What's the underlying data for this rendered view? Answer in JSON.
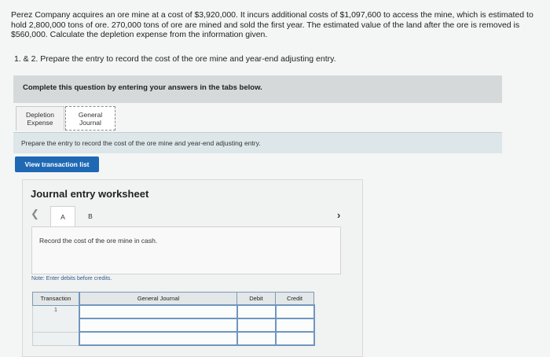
{
  "problem": {
    "text": "Perez Company acquires an ore mine at a cost of $3,920,000. It incurs additional costs of $1,097,600 to access the mine, which is estimated to hold 2,800,000 tons of ore. 270,000 tons of ore are mined and sold the first year. The estimated value of the land after the ore is removed is $560,000. Calculate the depletion expense from the information given.",
    "question": "1. & 2. Prepare the entry to record the cost of the ore mine and year-end adjusting entry."
  },
  "instructions": "Complete this question by entering your answers in the tabs below.",
  "tabs": {
    "depletion": [
      "Depletion",
      "Expense"
    ],
    "general": [
      "General",
      "Journal"
    ]
  },
  "prepare_text": "Prepare the entry to record the cost of the ore mine and year-end adjusting entry.",
  "view_button": "View transaction list",
  "worksheet": {
    "title": "Journal entry worksheet",
    "prev_icon": "chevron-left-icon",
    "next_icon": "chevron-right-icon",
    "entry_tabs": [
      "A",
      "B"
    ],
    "record_text": "Record the cost of the ore mine in cash.",
    "note": "Note: Enter debits before credits.",
    "table": {
      "headers": [
        "Transaction",
        "General Journal",
        "Debit",
        "Credit"
      ],
      "transaction_number": "1"
    }
  }
}
